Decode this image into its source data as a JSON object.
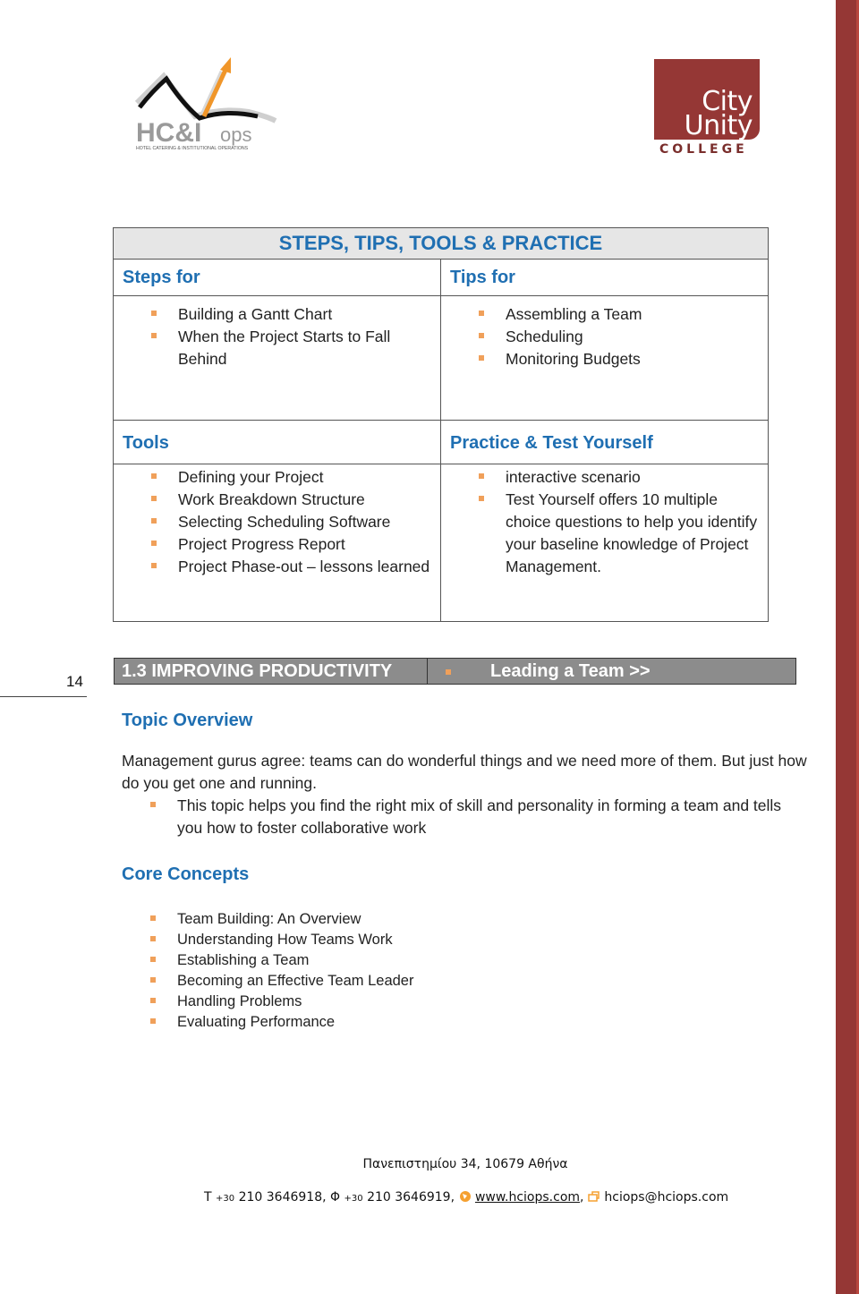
{
  "logos": {
    "left": {
      "name": "HC&I ops",
      "main": "HC&I",
      "suffix": "ops",
      "tagline": "HOTEL CATERING & INSTITUTIONAL OPERATIONS"
    },
    "right": {
      "line1": "City",
      "line2": "Unity",
      "line3": "COLLEGE"
    }
  },
  "summary_table": {
    "title": "STEPS, TIPS, TOOLS & PRACTICE",
    "steps": {
      "heading": "Steps for",
      "items": [
        "Building a Gantt Chart",
        "When the Project Starts to Fall Behind"
      ]
    },
    "tips": {
      "heading": "Tips for",
      "items": [
        "Assembling a Team",
        "Scheduling",
        "Monitoring Budgets"
      ]
    },
    "tools": {
      "heading": "Tools",
      "items": [
        "Defining your Project",
        "Work Breakdown Structure",
        "Selecting Scheduling Software",
        "Project Progress Report",
        "Project Phase-out – lessons learned"
      ]
    },
    "practice": {
      "heading": "Practice & Test Yourself",
      "items": [
        "interactive scenario",
        "Test Yourself offers 10 multiple choice questions to help you identify your baseline knowledge of Project Management."
      ]
    }
  },
  "page_number": "14",
  "section_banner": {
    "title": "1.3 IMPROVING PRODUCTIVITY",
    "link": "Leading a Team >>"
  },
  "topic_overview": {
    "heading": "Topic Overview",
    "paragraph": "Management gurus agree: teams can do wonderful things and we need more of them.  But just how do you get one and running.",
    "bullet": "This topic helps you find the right mix of skill and personality in forming a team and tells you how to foster collaborative work"
  },
  "core_concepts": {
    "heading": "Core Concepts",
    "items": [
      "Team Building: An Overview",
      "Understanding How Teams Work",
      "Establishing a Team",
      "Becoming an Effective Team Leader",
      "Handling Problems",
      "Evaluating Performance"
    ]
  },
  "footer": {
    "address": "Πανεπιστημίου 34, 10679 Αθήνα",
    "phone_label": "T",
    "phone_prefix": "+30",
    "phone": "210 3646918,",
    "fax_label": "Φ",
    "fax_prefix": "+30",
    "fax": "210 3646919,",
    "website": "www.hciops.com",
    "email": "hciops@hciops.com"
  },
  "colors": {
    "accent_blue": "#1f6fb2",
    "bullet_orange": "#f0a05a",
    "brand_red": "#953735",
    "banner_gray": "#8c8c8c"
  }
}
